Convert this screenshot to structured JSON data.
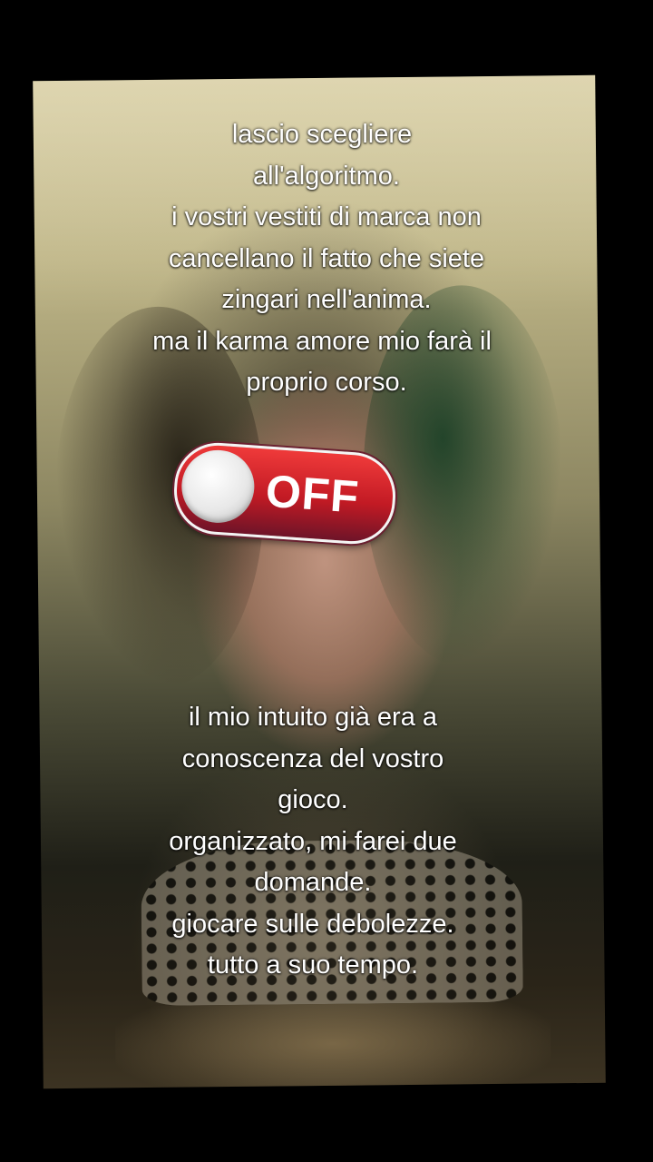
{
  "caption_top": [
    "lascio scegliere",
    "all'algoritmo.",
    "i vostri vestiti di marca non",
    "cancellano il fatto che siete",
    "zingari nell'anima.",
    "ma il karma amore mio farà il",
    "proprio corso."
  ],
  "toggle": {
    "label": "OFF",
    "state": "off",
    "color": "#d7222b"
  },
  "caption_bottom": [
    "il mio intuito già era a",
    "conoscenza del vostro",
    "gioco.",
    "organizzato, mi farei due",
    "domande.",
    "giocare sulle debolezze.",
    "tutto a suo tempo."
  ]
}
